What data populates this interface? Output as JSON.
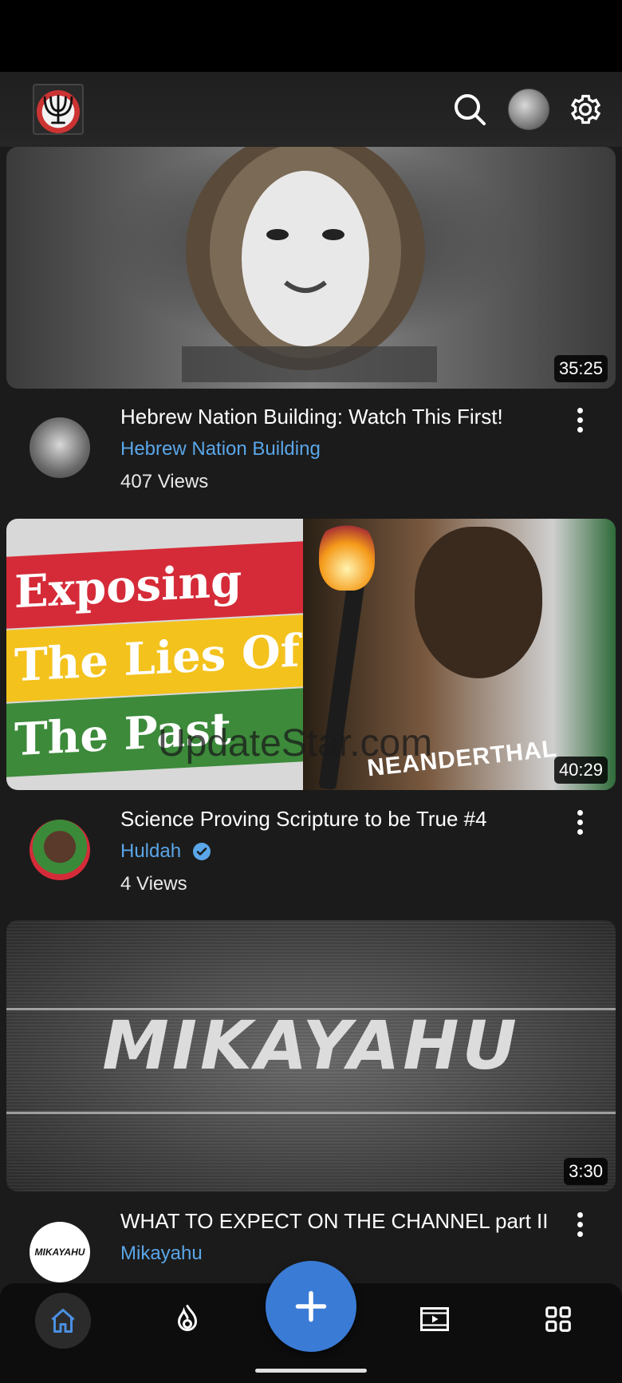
{
  "watermark": "UpdateStar.com",
  "videos": [
    {
      "title": "Hebrew Nation Building: Watch This First!",
      "channel": "Hebrew Nation Building",
      "views": "407 Views",
      "duration": "35:25",
      "verified": false
    },
    {
      "title": "Science Proving Scripture to be True #4",
      "channel": "Huldah",
      "views": "4 Views",
      "duration": "40:29",
      "verified": true,
      "thumb_text": [
        "Exposing",
        "The Lies Of",
        "The Past",
        "NEANDERTHAL"
      ]
    },
    {
      "title": "WHAT TO EXPECT ON THE CHANNEL part II",
      "channel": "Mikayahu",
      "views": "",
      "duration": "3:30",
      "verified": false,
      "thumb_text": "MIKAYAHU",
      "avatar_text": "MIKAYAHU"
    }
  ],
  "colors": {
    "background": "#1b1b1b",
    "channel_link": "#5aa6e8",
    "fab": "#3a7bd5",
    "active_nav": "#4a90e2"
  },
  "icons": {
    "header": [
      "app-logo",
      "search-icon",
      "account-avatar",
      "gear-icon"
    ],
    "nav": [
      "home-icon",
      "trending-icon",
      "add-icon",
      "subscriptions-icon",
      "library-icon"
    ]
  }
}
